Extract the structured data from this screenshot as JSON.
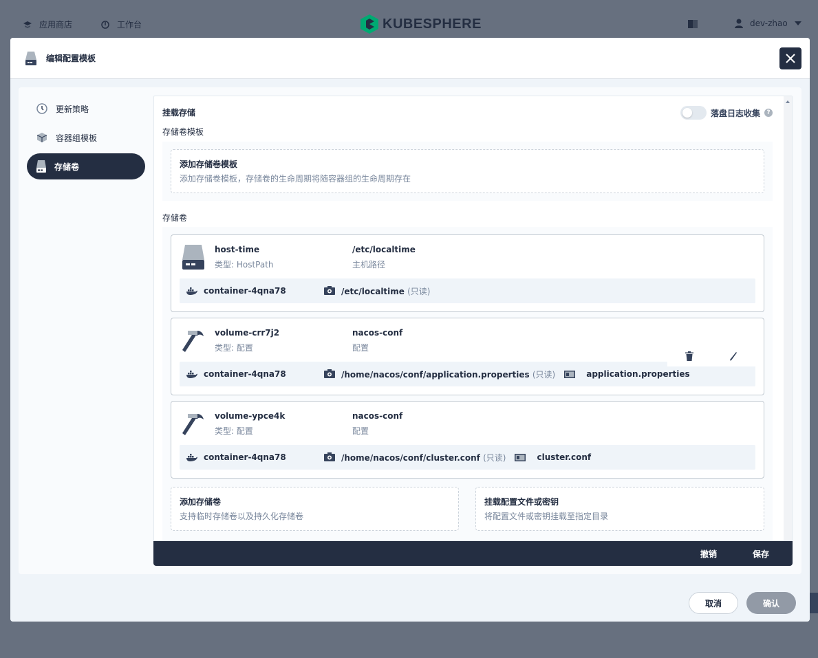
{
  "topnav": {
    "app_store": "应用商店",
    "workbench": "工作台",
    "logo_text": "KUBESPHERE",
    "username": "dev-zhao"
  },
  "modal": {
    "title": "编辑配置模板",
    "sidebar": [
      {
        "label": "更新策略",
        "icon": "clock-icon"
      },
      {
        "label": "容器组模板",
        "icon": "cube-icon"
      },
      {
        "label": "存储卷",
        "icon": "disk-icon",
        "active": true
      }
    ],
    "mount_storage": "挂载存储",
    "log_toggle_label": "落盘日志收集",
    "log_toggle_on": false,
    "help": "?",
    "volume_template_section": "存储卷模板",
    "add_template": {
      "title": "添加存储卷模板",
      "desc": "添加存储卷模板，存储卷的生命周期将随容器组的生命周期存在"
    },
    "volumes_section": "存储卷",
    "volumes": [
      {
        "name": "host-time",
        "type": "类型: HostPath",
        "path": "/etc/localtime",
        "path_type": "主机路径",
        "container": "container-4qna78",
        "mount_path": "/etc/localtime",
        "readonly": "(只读)",
        "file": ""
      },
      {
        "name": "volume-crr7j2",
        "type": "类型: 配置",
        "path": "nacos-conf",
        "path_type": "配置",
        "container": "container-4qna78",
        "mount_path": "/home/nacos/conf/application.properties",
        "readonly": "(只读)",
        "file": "application.properties"
      },
      {
        "name": "volume-ypce4k",
        "type": "类型: 配置",
        "path": "nacos-conf",
        "path_type": "配置",
        "container": "container-4qna78",
        "mount_path": "/home/nacos/conf/cluster.conf",
        "readonly": "(只读)",
        "file": "cluster.conf"
      }
    ],
    "add_volume": {
      "title": "添加存储卷",
      "desc": "支持临时存储卷以及持久化存储卷"
    },
    "mount_config": {
      "title": "挂载配置文件或密钥",
      "desc": "将配置文件或密钥挂载至指定目录"
    },
    "footer_bar": {
      "revert": "撤销",
      "save": "保存"
    },
    "buttons": {
      "cancel": "取消",
      "confirm": "确认"
    }
  }
}
